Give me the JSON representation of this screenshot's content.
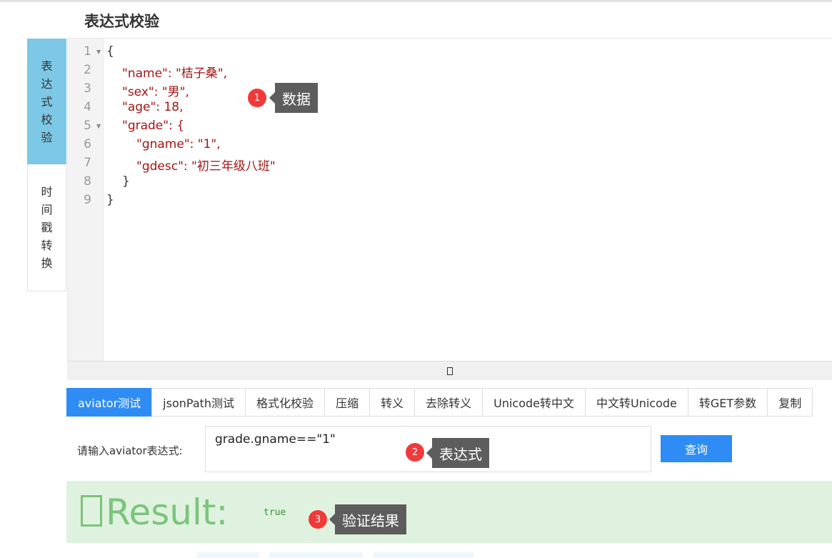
{
  "page": {
    "title": "表达式校验"
  },
  "sidebar": {
    "tabs": [
      {
        "label": "表达式校验",
        "active": true
      },
      {
        "label": "时间戳转换",
        "active": false
      }
    ]
  },
  "editor": {
    "line_numbers": [
      "1",
      "2",
      "3",
      "4",
      "5",
      "6",
      "7",
      "8",
      "9"
    ],
    "lines": [
      "{",
      "\"name\": \"桔子桑\",",
      "\"sex\": \"男\",",
      "\"age\": 18,",
      "\"grade\": {",
      "\"gname\": \"1\",",
      "\"gdesc\": \"初三年级八班\"",
      "}",
      "}"
    ]
  },
  "toolbar": {
    "buttons": [
      "aviator测试",
      "jsonPath测试",
      "格式化校验",
      "压缩",
      "转义",
      "去除转义",
      "Unicode转中文",
      "中文转Unicode",
      "转GET参数",
      "复制"
    ],
    "active_index": 0
  },
  "query": {
    "label": "请输入aviator表达式:",
    "value": "grade.gname==\"1\"",
    "button_label": "查询"
  },
  "result": {
    "label": "Result:",
    "value": "true"
  },
  "annotations": [
    {
      "number": "1",
      "text": "数据"
    },
    {
      "number": "2",
      "text": "表达式"
    },
    {
      "number": "3",
      "text": "验证结果"
    }
  ],
  "colors": {
    "primary": "#2f8cf4",
    "active_tab": "#7cc8e6",
    "result_bg": "#dff2df",
    "result_text": "#7cc47c",
    "badge": "#f03a3a",
    "callout_bg": "#5d5d5d"
  }
}
